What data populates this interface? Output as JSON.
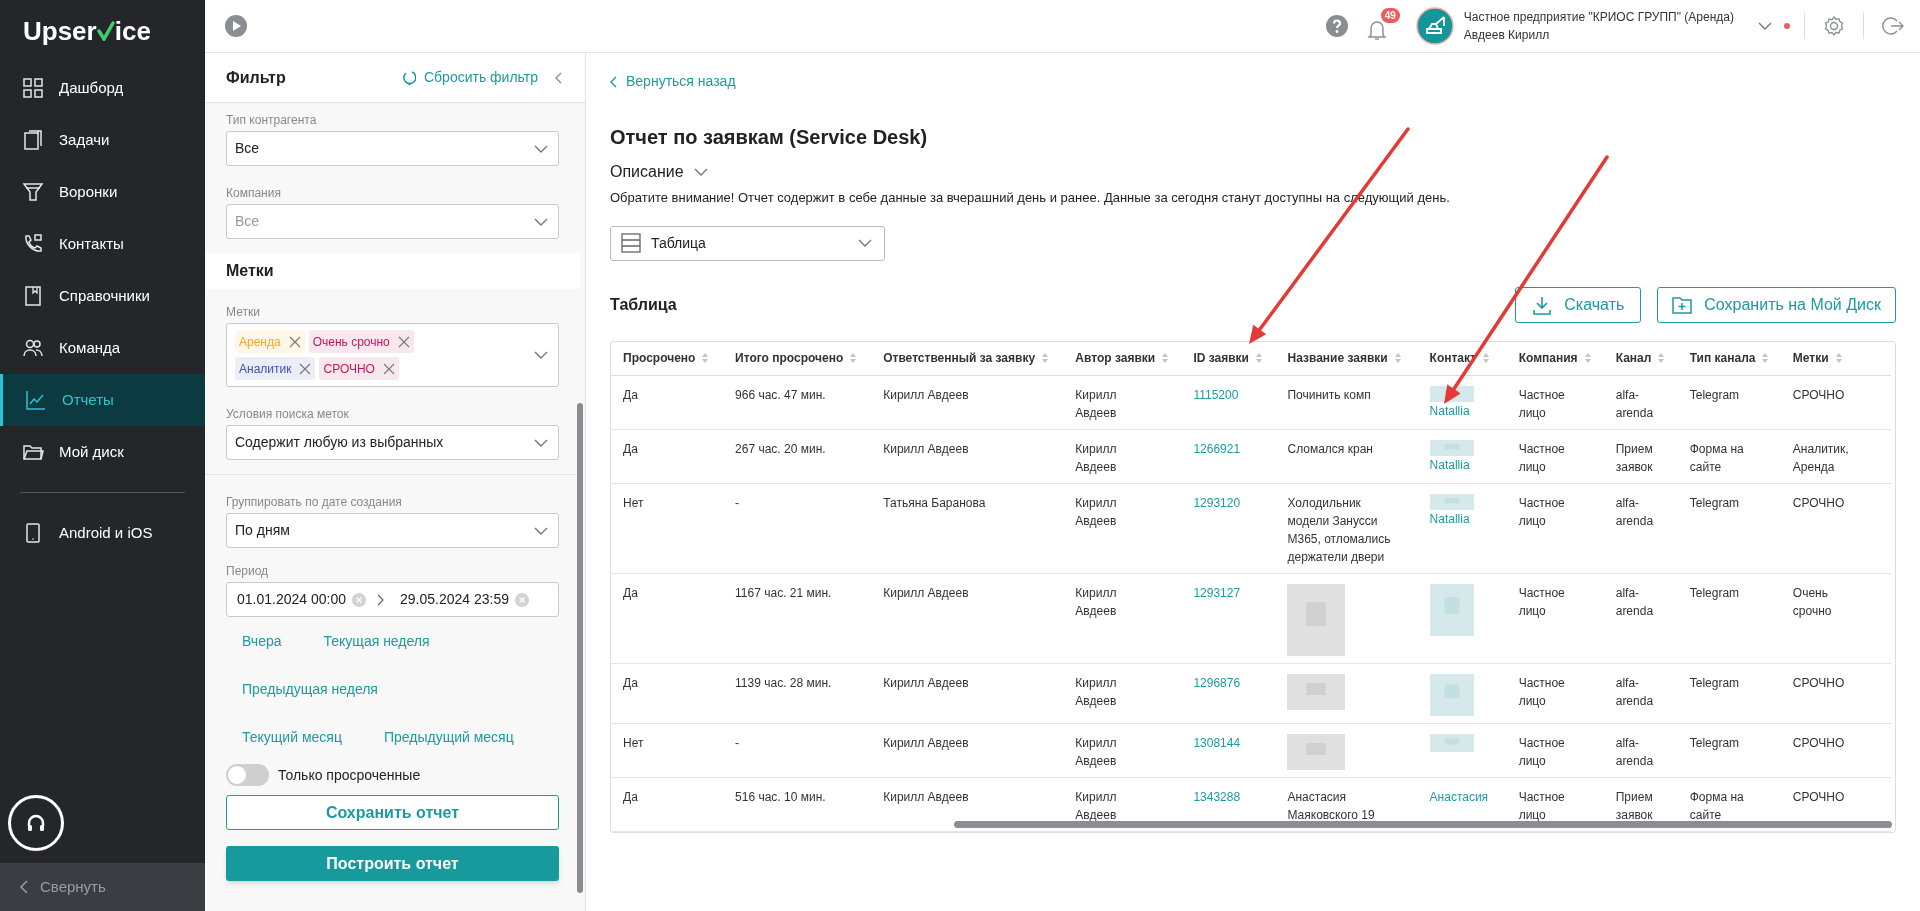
{
  "sidebar": {
    "logo": {
      "before": "Upser",
      "after": "ice"
    },
    "items": [
      {
        "label": "Дашборд",
        "selected": false
      },
      {
        "label": "Задачи",
        "selected": false
      },
      {
        "label": "Воронки",
        "selected": false
      },
      {
        "label": "Контакты",
        "selected": false
      },
      {
        "label": "Справочники",
        "selected": false
      },
      {
        "label": "Команда",
        "selected": false
      },
      {
        "label": "Отчеты",
        "selected": true
      },
      {
        "label": "Мой диск",
        "selected": false
      }
    ],
    "extra_items": [
      {
        "label": "Android и iOS",
        "selected": false
      }
    ],
    "collapse": "Свернуть"
  },
  "header": {
    "notifications": "49",
    "company": "Частное предприятие \"КРИОС ГРУПП\" (Аренда)",
    "user": "Авдеев Кирилл"
  },
  "filter": {
    "title": "Фильтр",
    "reset": "Сбросить фильтр",
    "fields": [
      {
        "label": "Тип контрагента",
        "value": "Все"
      },
      {
        "label": "Компания",
        "placeholder": "Все"
      }
    ],
    "tags_section": "Метки",
    "tags_label": "Метки",
    "tags": [
      {
        "label": "Аренда",
        "color": "#f5a623"
      },
      {
        "label": "Очень срочно",
        "color": "#c2185b"
      },
      {
        "label": "Аналитик",
        "color": "#3f51b5"
      },
      {
        "label": "СРОЧНО",
        "color": "#c2185b"
      }
    ],
    "tag_condition": {
      "label": "Условия поиска меток",
      "value": "Содержит любую из выбранных"
    },
    "group_by": {
      "label": "Группировать по дате создания",
      "value": "По дням"
    },
    "period": {
      "label": "Период",
      "from": "01.01.2024 00:00",
      "to": "29.05.2024 23:59"
    },
    "quick_periods": [
      [
        "Вчера",
        "Текущая неделя"
      ],
      [
        "Предыдущая неделя"
      ],
      [
        "Текущий месяц",
        "Предыдущий месяц"
      ]
    ],
    "overdue_only": {
      "label": "Только просроченные",
      "on": false
    },
    "save_button": "Сохранить отчет",
    "build_button": "Построить отчет"
  },
  "report": {
    "back": "Вернуться назад",
    "title": "Отчет по заявкам (Service Desk)",
    "description_toggle": "Описание",
    "notice": "Обратите внимание! Отчет содержит в себе данные за вчерашний день и ранее. Данные за сегодня станут доступны на следующий день.",
    "view": "Таблица",
    "table_title": "Таблица",
    "download": "Скачать",
    "save_to_disk": "Сохранить на Мой Диск",
    "table": {
      "columns": [
        "Просрочено",
        "Итого просрочено",
        "Ответственный за заявку",
        "Автор заявки",
        "ID заявки",
        "Название заявки",
        "Контакт",
        "Компания",
        "Канал",
        "Тип канала",
        "Метки"
      ],
      "rows": [
        {
          "overdue": "Да",
          "total_overdue": "966 час. 47 мин.",
          "responsible": "Кирилл Авдеев",
          "author": "Кирилл Авдеев",
          "id": "1115200",
          "title": "Починить комп",
          "title_redacted": false,
          "contact": "Natallia",
          "contact_redacted": true,
          "company": "Частное лицо",
          "channel": "alfa-arenda",
          "channel_type": "Telegram",
          "tags": "СРОЧНО"
        },
        {
          "overdue": "Да",
          "total_overdue": "267 час. 20 мин.",
          "responsible": "Кирилл Авдеев",
          "author": "Кирилл Авдеев",
          "id": "1266921",
          "title": "Сломался кран",
          "title_redacted": false,
          "contact": "Natallia",
          "contact_redacted": true,
          "company": "Частное лицо",
          "channel": "Прием заявок",
          "channel_type": "Форма на сайте",
          "tags": "Аналитик, Аренда"
        },
        {
          "overdue": "Нет",
          "total_overdue": "-",
          "responsible": "Татьяна Баранова",
          "author": "Кирилл Авдеев",
          "id": "1293120",
          "title": "Холодильник модели Занусси M365, отломались держатели двери",
          "title_redacted": false,
          "contact": "Natallia",
          "contact_redacted": true,
          "company": "Частное лицо",
          "channel": "alfa-arenda",
          "channel_type": "Telegram",
          "tags": "СРОЧНО"
        },
        {
          "overdue": "Да",
          "total_overdue": "1167 час. 21 мин.",
          "responsible": "Кирилл Авдеев",
          "author": "Кирилл Авдеев",
          "id": "1293127",
          "title_redacted": true,
          "contact_redacted": true,
          "company": "Частное лицо",
          "channel": "alfa-arenda",
          "channel_type": "Telegram",
          "tags": "Очень срочно"
        },
        {
          "overdue": "Да",
          "total_overdue": "1139 час. 28 мин.",
          "responsible": "Кирилл Авдеев",
          "author": "Кирилл Авдеев",
          "id": "1296876",
          "title_redacted": true,
          "contact_redacted": true,
          "company": "Частное лицо",
          "channel": "alfa-arenda",
          "channel_type": "Telegram",
          "tags": "СРОЧНО"
        },
        {
          "overdue": "Нет",
          "total_overdue": "-",
          "responsible": "Кирилл Авдеев",
          "author": "Кирилл Авдеев",
          "id": "1308144",
          "title_redacted": true,
          "contact_redacted": true,
          "company": "Частное лицо",
          "channel": "alfa-arenda",
          "channel_type": "Telegram",
          "tags": "СРОЧНО"
        },
        {
          "overdue": "Да",
          "total_overdue": "516 час. 10 мин.",
          "responsible": "Кирилл Авдеев",
          "author": "Кирилл Авдеев",
          "id": "1343288",
          "title": "Анастасия Маяковского 19",
          "title_redacted": false,
          "contact": "Анастасия",
          "contact_redacted": false,
          "company": "Частное лицо",
          "channel": "Прием заявок",
          "channel_type": "Форма на сайте",
          "tags": "СРОЧНО"
        }
      ]
    }
  },
  "annotations": [
    {
      "kind": "arrow"
    },
    {
      "kind": "arrow"
    }
  ]
}
